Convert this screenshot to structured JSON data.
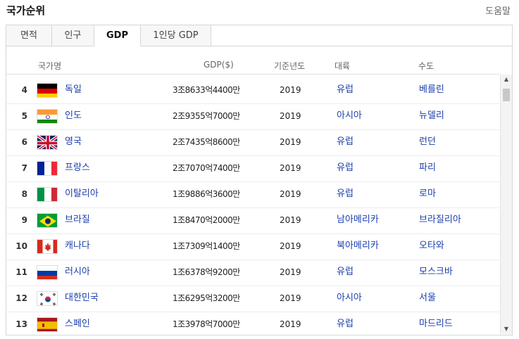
{
  "header": {
    "title": "국가순위",
    "help": "도움말"
  },
  "tabs": [
    {
      "label": "면적"
    },
    {
      "label": "인구"
    },
    {
      "label": "GDP"
    },
    {
      "label": "1인당 GDP"
    }
  ],
  "active_tab": "GDP",
  "columns": {
    "country": "국가명",
    "gdp": "GDP($)",
    "year": "기준년도",
    "continent": "대륙",
    "capital": "수도"
  },
  "rows": [
    {
      "rank": "4",
      "country": "독일",
      "gdp": "3조8633억4400만",
      "year": "2019",
      "continent": "유럽",
      "capital": "베를린"
    },
    {
      "rank": "5",
      "country": "인도",
      "gdp": "2조9355억7000만",
      "year": "2019",
      "continent": "아시아",
      "capital": "뉴델리"
    },
    {
      "rank": "6",
      "country": "영국",
      "gdp": "2조7435억8600만",
      "year": "2019",
      "continent": "유럽",
      "capital": "런던"
    },
    {
      "rank": "7",
      "country": "프랑스",
      "gdp": "2조7070억7400만",
      "year": "2019",
      "continent": "유럽",
      "capital": "파리"
    },
    {
      "rank": "8",
      "country": "이탈리아",
      "gdp": "1조9886억3600만",
      "year": "2019",
      "continent": "유럽",
      "capital": "로마"
    },
    {
      "rank": "9",
      "country": "브라질",
      "gdp": "1조8470억2000만",
      "year": "2019",
      "continent": "남아메리카",
      "capital": "브라질리아"
    },
    {
      "rank": "10",
      "country": "캐나다",
      "gdp": "1조7309억1400만",
      "year": "2019",
      "continent": "북아메리카",
      "capital": "오타와"
    },
    {
      "rank": "11",
      "country": "러시아",
      "gdp": "1조6378억9200만",
      "year": "2019",
      "continent": "유럽",
      "capital": "모스크바"
    },
    {
      "rank": "12",
      "country": "대한민국",
      "gdp": "1조6295억3200만",
      "year": "2019",
      "continent": "아시아",
      "capital": "서울"
    },
    {
      "rank": "13",
      "country": "스페인",
      "gdp": "1조3978억7000만",
      "year": "2019",
      "continent": "유럽",
      "capital": "마드리드"
    }
  ],
  "scroll": {
    "up": "▲",
    "down": "▼"
  },
  "colors": {
    "link": "#1a3dab",
    "border": "#d6d6d6"
  }
}
